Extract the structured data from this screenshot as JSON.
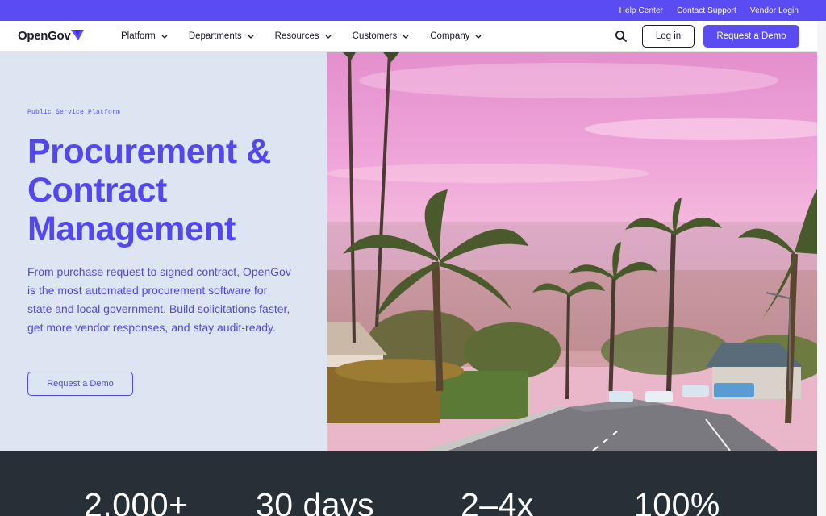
{
  "utility_bar": {
    "links": [
      "Help Center",
      "Contact Support",
      "Vendor Login"
    ]
  },
  "nav": {
    "logo_text": "OpenGov",
    "menu": [
      "Platform",
      "Departments",
      "Resources",
      "Customers",
      "Company"
    ],
    "login_label": "Log in",
    "demo_label": "Request a Demo"
  },
  "hero": {
    "eyebrow": "Public Service Platform",
    "title_lines": [
      "Procurement &",
      "Contract",
      "Management"
    ],
    "description": "From purchase request to signed contract, OpenGov is the most automated procurement software for state and local government. Build solicitations faster, get more vendor responses, and stay audit-ready.",
    "cta_label": "Request a Demo"
  },
  "stats": {
    "values": [
      "2,000+",
      "30 days",
      "2–4x",
      "100%"
    ]
  },
  "colors": {
    "brand": "#5a4cf2",
    "hero_bg": "#dde5f3",
    "stats_bg": "#263036"
  }
}
